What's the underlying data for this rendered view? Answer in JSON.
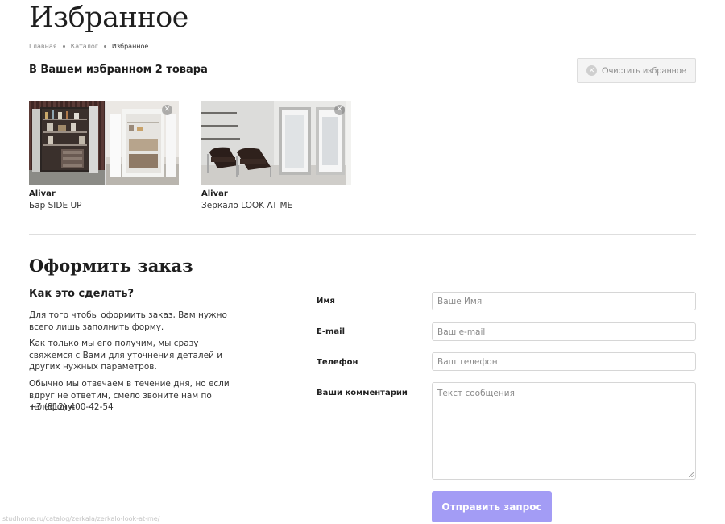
{
  "page": {
    "title": "Избранное"
  },
  "breadcrumb": {
    "items": [
      "Главная",
      "Каталог",
      "Избранное"
    ]
  },
  "favorites": {
    "heading": "В Вашем избранном 2 товара",
    "clear_label": "Очистить избранное",
    "clear_icon": "close-circle-icon",
    "products": [
      {
        "brand": "Alivar",
        "name": "Бар SIDE UP"
      },
      {
        "brand": "Alivar",
        "name": "Зеркало LOOK AT ME"
      }
    ]
  },
  "order": {
    "title": "Оформить заказ",
    "how_title": "Как это сделать?",
    "paragraphs": [
      "Для того чтобы оформить заказ, Вам нужно всего лишь заполнить форму.",
      "Как только мы его получим, мы сразу свяжемся с Вами для уточнения деталей и других нужных параметров.",
      "Обычно мы отвечаем в течение дня, но если вдруг не ответим, смело звоните нам по телефону:"
    ],
    "phone": "+7 (812) 400-42-54"
  },
  "form": {
    "name_label": "Имя",
    "name_placeholder": "Ваше Имя",
    "email_label": "E-mail",
    "email_placeholder": "Ваш e-mail",
    "phone_label": "Телефон",
    "phone_placeholder": "Ваш телефон",
    "comments_label": "Ваши комментарии",
    "comments_placeholder": "Текст сообщения",
    "submit_label": "Отправить запрос"
  },
  "status_bar": {
    "url": "studhome.ru/catalog/zerkala/zerkalo-look-at-me/"
  },
  "colors": {
    "accent": "#a39cf5",
    "text": "#1e1e1e",
    "muted": "#8a8a8a",
    "border": "#dedede"
  }
}
